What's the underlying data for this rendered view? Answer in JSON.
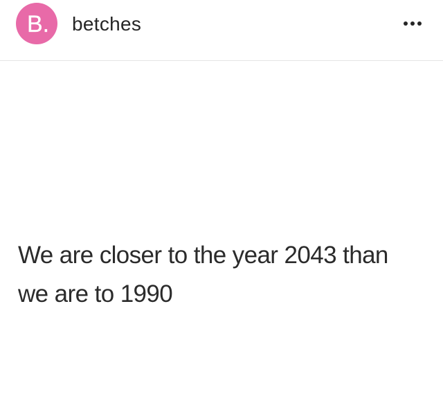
{
  "header": {
    "avatar_letter": "B.",
    "username": "betches",
    "more_icon": "ellipsis-horizontal-icon"
  },
  "post": {
    "text_lines": [
      "We are closer to the year 2043 than",
      "we are to 1990"
    ]
  },
  "colors": {
    "avatar_background": "#e86aa8",
    "text": "#262626",
    "divider": "#e4e4e4"
  }
}
